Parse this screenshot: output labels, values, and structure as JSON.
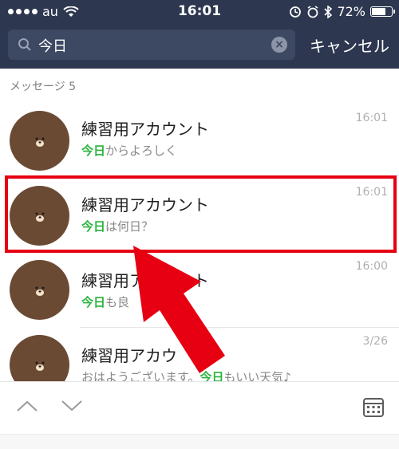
{
  "status_bar": {
    "carrier": "au",
    "time": "16:01",
    "battery": "72%",
    "battery_level": 0.72
  },
  "search": {
    "value": "今日",
    "cancel_label": "キャンセル"
  },
  "section": {
    "label": "メッセージ 5"
  },
  "messages": [
    {
      "name": "練習用アカウント",
      "highlight": "今日",
      "rest": "からよろしく",
      "time": "16:01"
    },
    {
      "name": "練習用アカウント",
      "highlight": "今日",
      "rest": "は何日？",
      "time": "16:01"
    },
    {
      "name": "練習用アカウント",
      "highlight": "今日",
      "rest": "も良",
      "time": "16:00"
    },
    {
      "name": "練習用アカウ",
      "pre": "おはようございます。",
      "highlight": "今日",
      "rest": "もいい天気♪",
      "time": "3/26"
    }
  ],
  "colors": {
    "header_bg": "#2d3750",
    "highlight_green": "#28b43c",
    "annotation_red": "#e60012",
    "avatar_brown": "#6b4a34"
  },
  "icons": [
    "search-icon",
    "clear-icon",
    "chevron-up-icon",
    "chevron-down-icon",
    "calendar-icon",
    "wifi-icon",
    "alarm-icon",
    "bluetooth-icon",
    "battery-icon"
  ]
}
